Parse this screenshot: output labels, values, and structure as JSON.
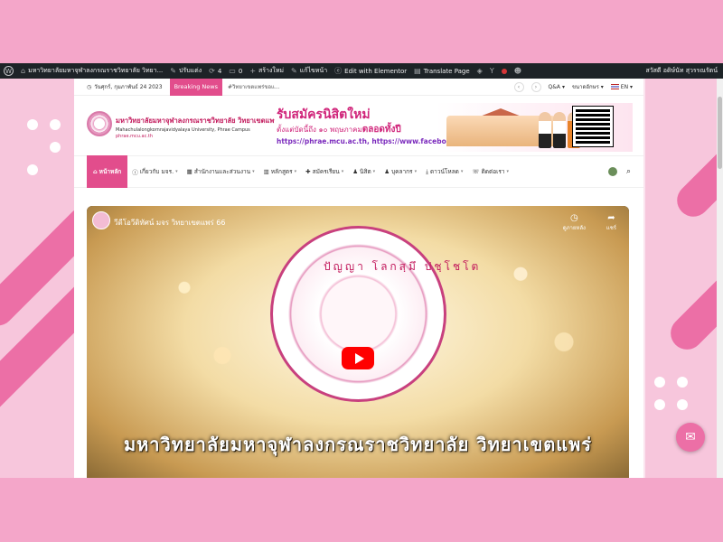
{
  "adminbar": {
    "site_name": "มหาวิทยาลัยมหาจุฬาลงกรณราชวิทยาลัย วิทยา...",
    "customize": "ปรับแต่ง",
    "updates": "4",
    "comments": "0",
    "new": "สร้างใหม่",
    "edit_page": "แก้ไขหน้า",
    "elementor": "Edit with Elementor",
    "translate": "Translate Page",
    "user": "สวัสดี อดิษ์นัท สุวรรณรัตน์"
  },
  "topbar": {
    "date": "วันศุกร์, กุมภาพันธ์ 24 2023",
    "breaking": "Breaking News",
    "ticker": "#วิทยาเขตแพร่ขอแ...",
    "qa": "Q&A",
    "font_size": "ขนาดอักษร",
    "lang": "EN"
  },
  "header": {
    "logo_th": "มหาวิทยาลัยมหาจุฬาลงกรณราชวิทยาลัย วิทยาเขตแพร่",
    "logo_en": "Mahachulalongkornrajavidyalaya University, Phrae Campus",
    "logo_url": "phrae.mcu.ac.th",
    "banner_line1": "รับสมัครนิสิตใหม่",
    "banner_line2a": "ตั้งแต่บัดนี้ถึง ๑๐ พฤษภาคม",
    "banner_line2b": "ตลอดทั้งปี",
    "banner_line3": "https://phrae.mcu.ac.th, https://www.facebook.com/mcupr"
  },
  "nav": {
    "home": "หน้าหลัก",
    "items": [
      "เกี่ยวกับ มจร.",
      "สำนักงานและส่วนงาน",
      "หลักสูตร",
      "สมัครเรียน",
      "นิสิต",
      "บุคลากร",
      "ดาวน์โหลด",
      "ติดต่อเรา"
    ]
  },
  "video": {
    "title": "วีดีโอวีดิทัศน์ มจร วิทยาเขตแพร่ 66",
    "watch_later": "ดูภายหลัง",
    "share": "แชร์",
    "seal_text": "ปัญญา โลกสฺมึ ปชฺโชโต",
    "caption": "มหาวิทยาลัยมหาจุฬาลงกรณราชวิทยาลัย วิทยาเขตแพร่"
  },
  "colors": {
    "accent": "#e24d8c",
    "page_bg": "#f4a6c9",
    "adminbar": "#1d2327"
  }
}
